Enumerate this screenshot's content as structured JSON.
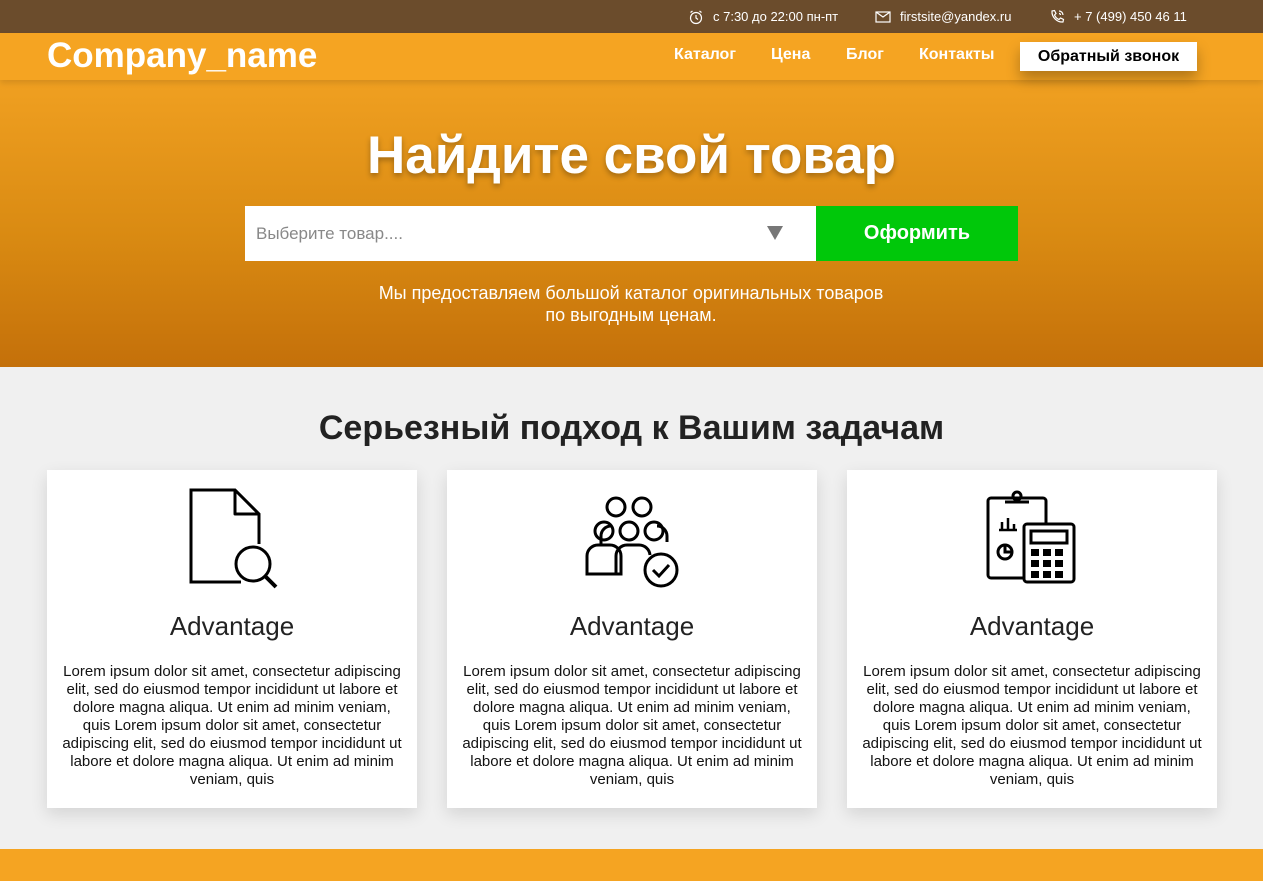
{
  "topbar": {
    "hours": "с 7:30 до 22:00 пн-пт",
    "email": "firstsite@yandex.ru",
    "phone": "+ 7 (499) 450 46 11",
    "icons": [
      "clock-icon",
      "envelope-icon",
      "phone-icon"
    ]
  },
  "header": {
    "logo": "Company_name",
    "nav": [
      "Каталог",
      "Цена",
      "Блог",
      "Контакты"
    ],
    "callback_label": "Обратный звонок"
  },
  "hero": {
    "title": "Найдите свой товар",
    "select_placeholder": "Выберите товар....",
    "submit_label": "Оформить",
    "subtitle": "Мы предоставляем большой каталог оригинальных товаров по выгодным ценам."
  },
  "advantages": {
    "title": "Серьезный подход к Вашим задачам",
    "cards": [
      {
        "icon": "document-search-icon",
        "title": "Advantage",
        "text": "Lorem ipsum dolor sit amet, consectetur adipiscing elit, sed do eiusmod tempor incididunt ut labore et dolore magna aliqua. Ut enim ad minim veniam, quis Lorem ipsum dolor sit amet, consectetur adipiscing elit, sed do eiusmod tempor incididunt ut labore et dolore magna aliqua. Ut enim ad minim veniam, quis"
      },
      {
        "icon": "team-check-icon",
        "title": "Advantage",
        "text": "Lorem ipsum dolor sit amet, consectetur adipiscing elit, sed do eiusmod tempor incididunt ut labore et dolore magna aliqua. Ut enim ad minim veniam, quis Lorem ipsum dolor sit amet, consectetur adipiscing elit, sed do eiusmod tempor incididunt ut labore et dolore magna aliqua. Ut enim ad minim veniam, quis"
      },
      {
        "icon": "clipboard-calculator-icon",
        "title": "Advantage",
        "text": "Lorem ipsum dolor sit amet, consectetur adipiscing elit, sed do eiusmod tempor incididunt ut labore et dolore magna aliqua. Ut enim ad minim veniam, quis Lorem ipsum dolor sit amet, consectetur adipiscing elit, sed do eiusmod tempor incididunt ut labore et dolore magna aliqua. Ut enim ad minim veniam, quis"
      }
    ]
  },
  "colors": {
    "topbar_bg": "#6b4c2c",
    "accent_orange": "#f5a422",
    "submit_green": "#00c80a",
    "section_bg": "#f0f0f0"
  }
}
